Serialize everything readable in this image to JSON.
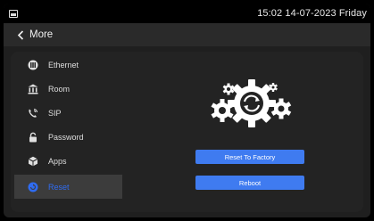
{
  "statusbar": {
    "time_date": "15:02 14-07-2023 Friday"
  },
  "header": {
    "back_label": "More"
  },
  "menu": {
    "items": [
      {
        "label": "Ethernet",
        "icon": "ethernet-icon"
      },
      {
        "label": "Room",
        "icon": "bank-icon"
      },
      {
        "label": "SIP",
        "icon": "phone-icon"
      },
      {
        "label": "Password",
        "icon": "lock-icon"
      },
      {
        "label": "Apps",
        "icon": "cube-icon"
      },
      {
        "label": "Reset",
        "icon": "reset-icon",
        "selected": true
      }
    ]
  },
  "reset": {
    "illustration": "gears-reset-icon",
    "factory_button": "Reset To Factory",
    "reboot_button": "Reboot"
  },
  "colors": {
    "accent": "#3f7bf0",
    "selected_text": "#2f6cf2",
    "background": "#1f1f1f"
  }
}
